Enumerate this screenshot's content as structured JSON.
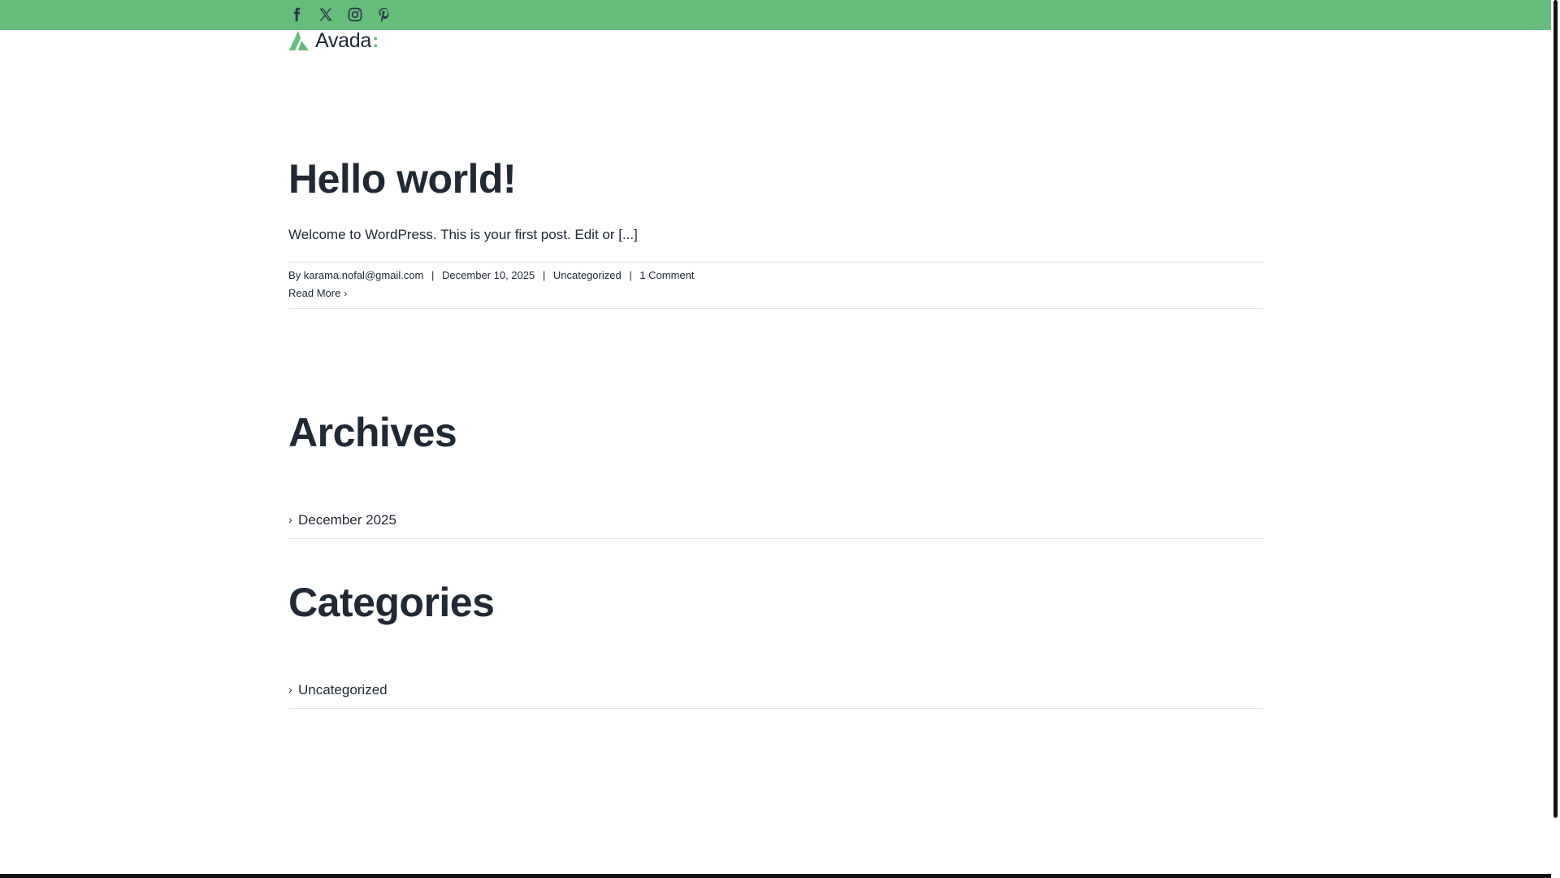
{
  "header": {
    "social_icons": [
      "facebook-icon",
      "x-icon",
      "instagram-icon",
      "pinterest-icon"
    ],
    "logo_text": "Avada",
    "accent_color": "#65bc7b"
  },
  "post": {
    "title": "Hello world!",
    "excerpt": "Welcome to WordPress. This is your first post. Edit or [...]",
    "meta": {
      "by": "By",
      "author": "karama.nofal@gmail.com",
      "date": "December 10, 2025",
      "category": "Uncategorized",
      "comments": "1 Comment"
    },
    "read_more": "Read More"
  },
  "archives": {
    "title": "Archives",
    "items": [
      "December 2025"
    ]
  },
  "categories": {
    "title": "Categories",
    "items": [
      "Uncategorized"
    ]
  }
}
